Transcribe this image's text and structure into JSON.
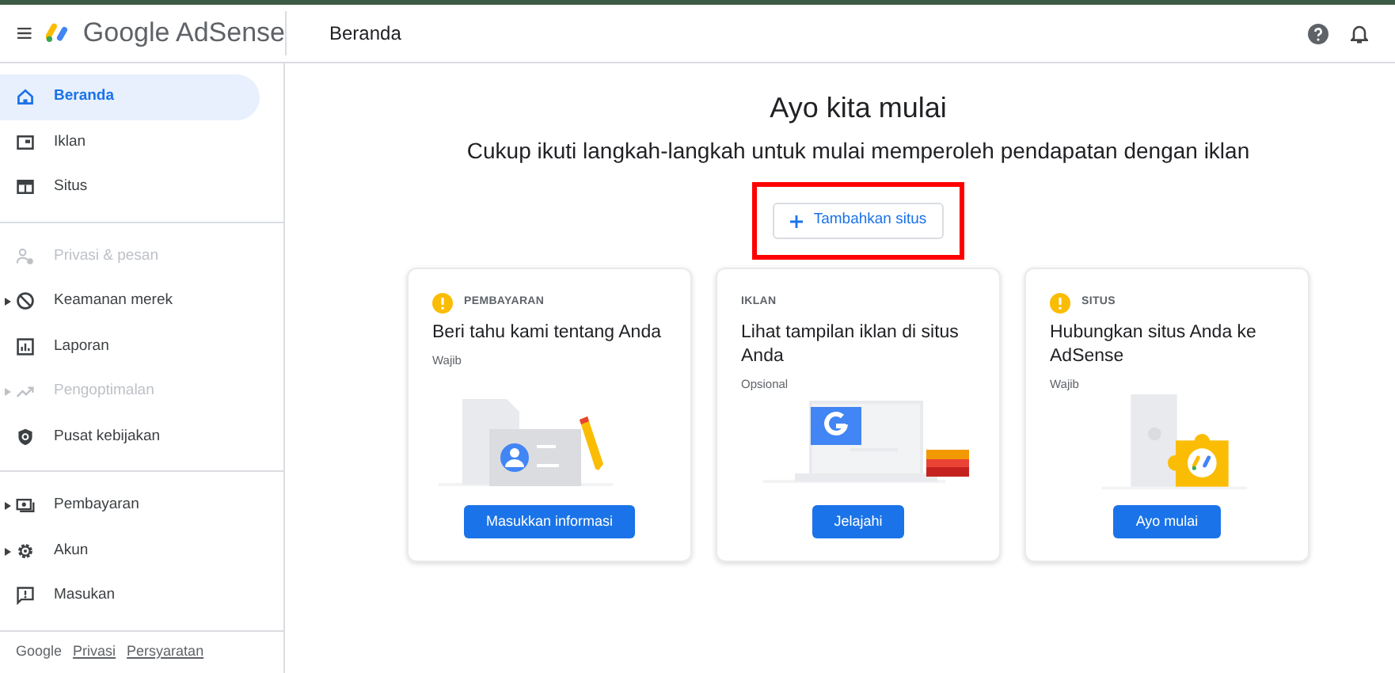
{
  "header": {
    "brand": "Google AdSense",
    "page_title": "Beranda"
  },
  "sidebar": {
    "sections": [
      {
        "items": [
          {
            "label": "Beranda",
            "selected": true,
            "disabled": false,
            "expandable": false
          },
          {
            "label": "Iklan",
            "selected": false,
            "disabled": false,
            "expandable": false
          },
          {
            "label": "Situs",
            "selected": false,
            "disabled": false,
            "expandable": false
          }
        ]
      },
      {
        "items": [
          {
            "label": "Privasi & pesan",
            "selected": false,
            "disabled": true,
            "expandable": false
          },
          {
            "label": "Keamanan merek",
            "selected": false,
            "disabled": false,
            "expandable": true
          },
          {
            "label": "Laporan",
            "selected": false,
            "disabled": false,
            "expandable": false
          },
          {
            "label": "Pengoptimalan",
            "selected": false,
            "disabled": true,
            "expandable": true
          },
          {
            "label": "Pusat kebijakan",
            "selected": false,
            "disabled": false,
            "expandable": false
          }
        ]
      },
      {
        "items": [
          {
            "label": "Pembayaran",
            "selected": false,
            "disabled": false,
            "expandable": true
          },
          {
            "label": "Akun",
            "selected": false,
            "disabled": false,
            "expandable": true
          },
          {
            "label": "Masukan",
            "selected": false,
            "disabled": false,
            "expandable": false
          }
        ]
      }
    ],
    "footer": {
      "brand": "Google",
      "links": [
        "Privasi",
        "Persyaratan"
      ]
    }
  },
  "main": {
    "title": "Ayo kita mulai",
    "subtitle": "Cukup ikuti langkah-langkah untuk mulai memperoleh pendapatan dengan iklan",
    "add_button": {
      "label": "Tambahkan situs",
      "highlighted": true
    },
    "cards": [
      {
        "warning": true,
        "category": "PEMBAYARAN",
        "title": "Beri tahu kami tentang Anda",
        "requirement": "Wajib",
        "kind": "profile",
        "button": "Masukkan informasi"
      },
      {
        "warning": false,
        "category": "IKLAN",
        "title": "Lihat tampilan iklan di situs Anda",
        "requirement": "Opsional",
        "kind": "ads",
        "button": "Jelajahi"
      },
      {
        "warning": true,
        "category": "SITUS",
        "title": "Hubungkan situs Anda ke AdSense",
        "requirement": "Wajib",
        "kind": "puzzle",
        "button": "Ayo mulai"
      }
    ]
  }
}
